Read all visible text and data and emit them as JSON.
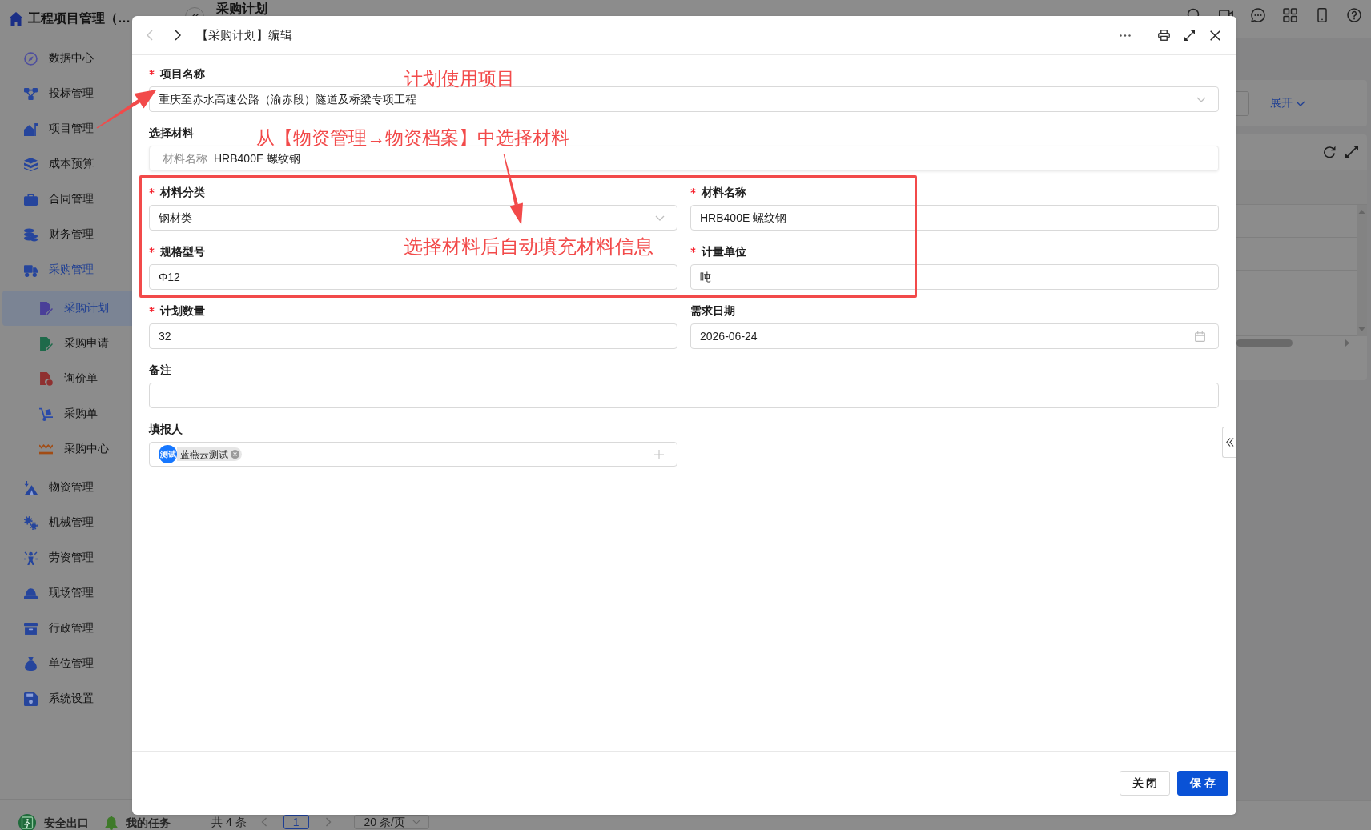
{
  "app_header": {
    "title": "工程项目管理（…",
    "page_title": "采购计划"
  },
  "sidebar": {
    "items": [
      {
        "label": "数据中心",
        "selected": false,
        "expanded": false
      },
      {
        "label": "投标管理",
        "selected": false,
        "expanded": false
      },
      {
        "label": "项目管理",
        "selected": false,
        "expanded": false
      },
      {
        "label": "成本预算",
        "selected": false,
        "expanded": false
      },
      {
        "label": "合同管理",
        "selected": false,
        "expanded": false
      },
      {
        "label": "财务管理",
        "selected": false,
        "expanded": false
      },
      {
        "label": "采购管理",
        "selected": false,
        "expanded": true,
        "children": [
          {
            "label": "采购计划",
            "selected": true
          },
          {
            "label": "采购申请",
            "selected": false
          },
          {
            "label": "询价单",
            "selected": false
          },
          {
            "label": "采购单",
            "selected": false
          },
          {
            "label": "采购中心",
            "selected": false
          }
        ]
      },
      {
        "label": "物资管理",
        "selected": false,
        "expanded": false
      },
      {
        "label": "机械管理",
        "selected": false,
        "expanded": false
      },
      {
        "label": "劳资管理",
        "selected": false,
        "expanded": false
      },
      {
        "label": "现场管理",
        "selected": false,
        "expanded": false
      },
      {
        "label": "行政管理",
        "selected": false,
        "expanded": false
      },
      {
        "label": "单位管理",
        "selected": false,
        "expanded": false
      },
      {
        "label": "系统设置",
        "selected": false,
        "expanded": false
      }
    ],
    "footer": [
      {
        "label": "安全出口"
      },
      {
        "label": "我的任务"
      }
    ]
  },
  "page": {
    "filter_toggle": "展开",
    "pagination": {
      "total": "共 4 条",
      "pages": [
        {
          "label": "1",
          "selected": true
        }
      ],
      "page_size": "20 条/页"
    }
  },
  "dialog": {
    "nav": [
      {
        "kind": "prev",
        "disabled": true
      },
      {
        "kind": "next",
        "disabled": false
      }
    ],
    "title": "【采购计划】编辑",
    "fields": [
      {
        "label": "项目名称",
        "required": true,
        "kind": "select",
        "full_width": true,
        "value": "重庆至赤水高速公路（渝赤段）隧道及桥梁专项工程"
      },
      {
        "label": "选择材料",
        "required": false,
        "kind": "picker",
        "full_width": true,
        "prefix": "材料名称",
        "value": "HRB400E 螺纹钢"
      },
      {
        "label": "材料分类",
        "required": true,
        "kind": "select",
        "full_width": false,
        "value": "钢材类"
      },
      {
        "label": "材料名称",
        "required": true,
        "kind": "text",
        "full_width": false,
        "value": "HRB400E 螺纹钢"
      },
      {
        "label": "规格型号",
        "required": true,
        "kind": "text",
        "full_width": false,
        "value": "Φ12"
      },
      {
        "label": "计量单位",
        "required": true,
        "kind": "text",
        "full_width": false,
        "value": "吨"
      },
      {
        "label": "计划数量",
        "required": true,
        "kind": "text",
        "full_width": false,
        "value": "32"
      },
      {
        "label": "需求日期",
        "required": false,
        "kind": "date",
        "full_width": false,
        "value": "2026-06-24"
      },
      {
        "label": "备注",
        "required": false,
        "kind": "text",
        "full_width": true
      },
      {
        "label": "填报人",
        "required": false,
        "kind": "members",
        "full_width": false,
        "members": [
          {
            "badge": "测试",
            "name": "蓝燕云测试"
          }
        ]
      }
    ],
    "buttons": [
      {
        "label": "关 闭",
        "kind": "default"
      },
      {
        "label": "保 存",
        "kind": "primary"
      }
    ]
  },
  "annotations": {
    "notes": [
      "计划使用项目",
      "从【物资管理→物资档案】中选择材料",
      "选择材料后自动填充材料信息"
    ]
  }
}
